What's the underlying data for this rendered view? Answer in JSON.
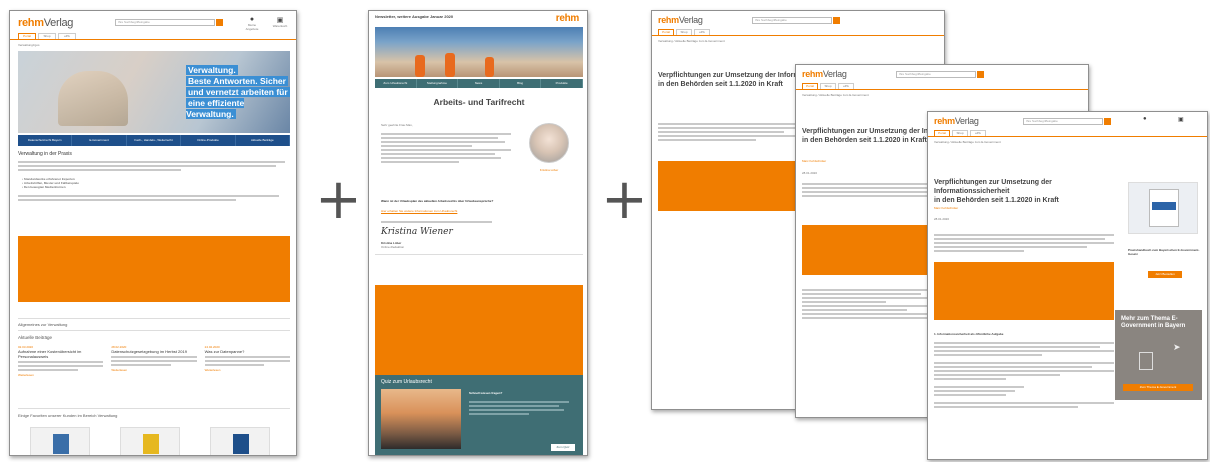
{
  "plus_sign": "+",
  "screen1": {
    "logo": "rehm",
    "logo_suffix": "Verlag",
    "search_placeholder": "Ihre Suchbegriffeingabe",
    "header_icons": [
      {
        "icon": "user-icon",
        "label": "Meine Angebote"
      },
      {
        "icon": "cart-icon",
        "label": "Warenkorb"
      }
    ],
    "tabs": [
      "Portal",
      "Shop",
      "ePA"
    ],
    "breadcrumb": "Verwaltung/rgos",
    "banner_lines": [
      "Verwaltung.",
      "Beste Antworten. Sicher",
      "und vernetzt arbeiten für",
      "eine effiziente Verwaltung."
    ],
    "nav": [
      "Datenschutzrecht Bayern",
      "E-Government",
      "Fach-, Handels-, Weiterrecht",
      "Online-Produkte",
      "Aktuelle Beiträge"
    ],
    "section_title": "Verwaltung in der Praxis",
    "bullets": [
      "Standardwerke erfahrener Experten",
      "Arbeitshilfen, Muster und Fallbeispiele",
      "Den bewegten Medienformen"
    ],
    "topics_heading": "Allgemeines zur Verwaltung",
    "recent_heading": "Aktuelle Beiträge",
    "articles": [
      {
        "date": "02.03.2020",
        "title": "Aufnahme einer Kostenübersicht im Personalausweis"
      },
      {
        "date": "28.02.2020",
        "title": "Datenschutzgesetzgebung im Herbst 2019"
      },
      {
        "date": "24.02.2020",
        "title": "Was zur Datenpanne?"
      }
    ],
    "more_link": "Weiterlesen",
    "favorites_heading": "Einige Favoriten unserer Kunden im Bereich Verwaltung"
  },
  "screen2": {
    "title_bar": "Newsletter, weitere Ausgabe Januar 2020",
    "logo": "rehm",
    "nav": [
      "Zum Urlaubsrecht",
      "Stellungnahme",
      "News",
      "Blog",
      "Produkte"
    ],
    "heading": "Arbeits- und Tarifrecht",
    "greeting": "Sehr geehrte Frau Max,",
    "question": "Wann ist der Urlaubsplan des aktuellen Arbeitsrechts über Urlaubsansprüche?",
    "link_text": "Hier erhalten Sie weitere Informationen zum Urlaubsrecht",
    "signature": "Kristina Wiener",
    "signer_name": "Kristina Löber",
    "signer_role": "Online-Redaktion",
    "photo_caption": "Kristina Löber",
    "quiz_heading": "Quiz zum Urlaubsrecht",
    "quiz_text": "Schnell wissen fragen?",
    "quiz_button": "Zum Quiz"
  },
  "screen3": {
    "logo": "rehm",
    "logo_suffix": "Verlag",
    "search_placeholder": "Ihre Suchbegriffeingabe",
    "tabs": [
      "Portal",
      "Shop",
      "ePA"
    ],
    "breadcrumb": "Verwaltung / Aktuelle Beiträge zum E-Government",
    "title_line1": "Verpflichtungen zur Umsetzung der Informationssicherheit",
    "title_line2": "in den Behörden seit 1.1.2020 in Kraft",
    "author": "Marc Kohlschütter",
    "date": "28.01.2020",
    "subheading": "1. Informationssicherheit als öffentliche Aufgabe",
    "side_product_title": "Praxishandbuch zum Bayerischen E-Government-Gesetz",
    "side_cta": "Jetzt Bestellen",
    "promo_title": "Mehr zum Thema E-Government in Bayern",
    "promo_button": "Zum Thema E-Government"
  },
  "colors": {
    "brand": "#f07d00",
    "nav_blue": "#1e4f8a",
    "teal": "#3f6e74",
    "promo_grey": "#8a8580"
  }
}
